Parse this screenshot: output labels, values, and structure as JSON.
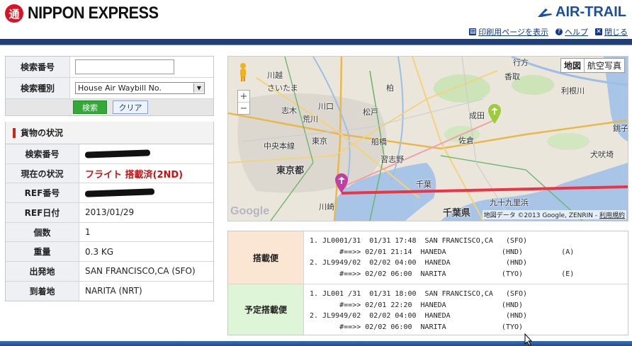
{
  "header": {
    "brand_mark": "通",
    "brand_name": "NIPPON EXPRESS",
    "airtrail": "AIR-TRAIL",
    "links": [
      {
        "label": "印刷用ページを表示",
        "icon": "print-icon"
      },
      {
        "label": "ヘルプ",
        "icon": "help-icon"
      },
      {
        "label": "閉じる",
        "icon": "close-icon"
      }
    ]
  },
  "search": {
    "number_label": "検索番号",
    "number_value": "",
    "type_label": "検索種別",
    "type_value": "House Air Waybill No.",
    "search_button": "検索",
    "clear_button": "クリア"
  },
  "cargo_status": {
    "section_title": "貨物の状況",
    "rows": [
      {
        "label": "検索番号",
        "value": "",
        "redacted": true
      },
      {
        "label": "現在の状況",
        "value": "フライト 搭載済(2ND)"
      },
      {
        "label": "REF番号",
        "value": "",
        "redacted": true
      },
      {
        "label": "REF日付",
        "value": "2013/01/29"
      },
      {
        "label": "個数",
        "value": "1"
      },
      {
        "label": "重量",
        "value": "0.3 KG"
      },
      {
        "label": "出発地",
        "value": "SAN FRANCISCO,CA (SFO)"
      },
      {
        "label": "到着地",
        "value": "NARITA (NRT)"
      }
    ]
  },
  "map": {
    "type_map": "地図",
    "type_satellite": "航空写真",
    "zoom_in": "+",
    "zoom_out": "−",
    "attribution": "地図データ ©2013 Google, ZENRIN",
    "terms": "利用規約",
    "logo": "Google",
    "labels": {
      "kawagoe": "川越",
      "saitama": "さいたま",
      "kashiwa": "柏",
      "gyotoku": "行方",
      "katori": "香取",
      "tone": "利根川",
      "kawaguchi": "川口",
      "shiki": "志木",
      "arakawa": "荒川",
      "matsudo": "松戸",
      "narita": "成田",
      "chuo": "中央本線",
      "tokyo": "東京",
      "funabashi": "船橋",
      "sakura": "佐倉",
      "choshi": "銚子",
      "inubo": "犬吠埼",
      "tokyoto": "東京都",
      "narashino": "習志野",
      "chiba": "千葉",
      "kujukuri": "九十九里浜",
      "kawasaki": "川崎",
      "chibaken": "千葉県"
    },
    "colors": {
      "route": "#ee3344",
      "route_faint": "#f2a0a8",
      "pin": "#c040a0",
      "pin_green": "#9ccc3a",
      "water": "#a8c5e8"
    }
  },
  "flights": {
    "loaded_label": "搭載便",
    "loaded_lines": [
      "1. JL0001/31  01/31 17:48  SAN FRANCISCO,CA   (SFO)",
      "       #==>> 02/01 21:14  HANEDA             (HND)         (A)",
      "2. JL9949/02  02/02 04:00  HANEDA             (HND)",
      "       #==>> 02/02 06:00  NARITA             (TYO)         (E)"
    ],
    "planned_label": "予定搭載便",
    "planned_lines": [
      "1. JL001 /31  01/31 18:00  SAN FRANCISCO,CA   (SFO)",
      "       #==>> 02/01 22:20  HANEDA             (HND)",
      "2. JL9949/02  02/02 04:00  HANEDA             (HND)",
      "       #==>> 02/02 06:00  NARITA             (TYO)"
    ]
  }
}
